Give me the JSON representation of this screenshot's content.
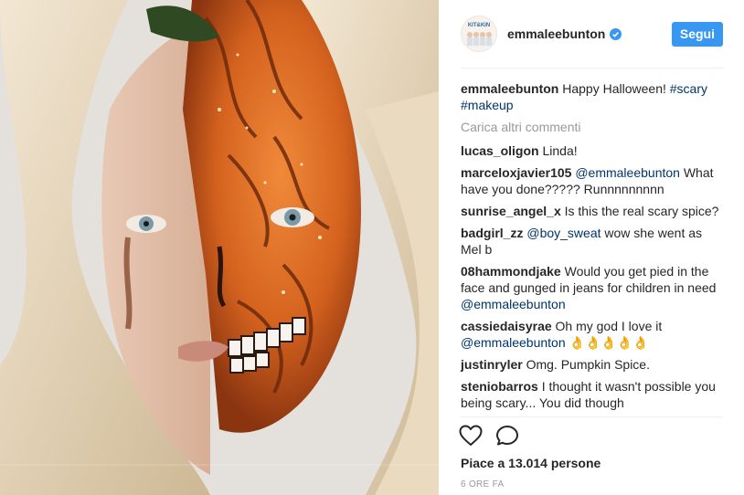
{
  "post": {
    "username": "emmaleebunton",
    "verified_icon": "verified-badge-icon",
    "follow_label": "Segui",
    "avatar_text": "KIT&KIN",
    "caption": {
      "username": "emmaleebunton",
      "text": "Happy Halloween!",
      "hashtags": [
        "#scary",
        "#makeup"
      ]
    },
    "load_more_label": "Carica altri commenti",
    "comments": [
      {
        "user": "lucas_oligon",
        "text": "Linda!"
      },
      {
        "user": "marceloxjavier105",
        "mention": "@emmaleebunton",
        "text": "What have you done????? Runnnnnnnnn"
      },
      {
        "user": "sunrise_angel_x",
        "text": "Is this the real scary spice?"
      },
      {
        "user": "badgirl_zz",
        "mention": "@boy_sweat",
        "text": "wow she went as Mel b"
      },
      {
        "user": "08hammondjake",
        "text": "Would you get pied in the face and gunged in jeans for children in need",
        "mention_after": "@emmaleebunton"
      },
      {
        "user": "cassiedaisyrae",
        "text": "Oh my god I love it",
        "mention_after": "@emmaleebunton",
        "emoji": "👌👌👌👌👌"
      },
      {
        "user": "justinryler",
        "text": "Omg. Pumpkin Spice."
      },
      {
        "user": "steniobarros",
        "text": "I thought it wasn't possible you being scary... You did though"
      }
    ],
    "likes_text": "Piace a 13.014 persone",
    "time_text": "6 ORE FA",
    "accent_color": "#3897f0",
    "link_color": "#003569"
  }
}
